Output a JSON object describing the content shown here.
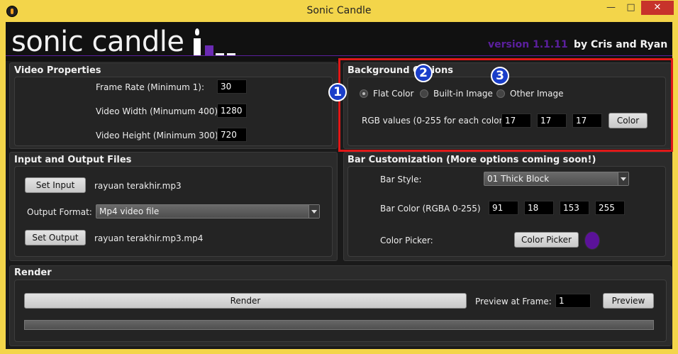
{
  "window": {
    "title": "Sonic Candle",
    "minimize": "—",
    "maximize": "□",
    "close": "✕"
  },
  "header": {
    "logo": "sonic candle",
    "version": "version 1.1.11",
    "authors": "by Cris and Ryan"
  },
  "video_properties": {
    "title": "Video Properties",
    "frame_rate_label": "Frame Rate (Minimum 1):",
    "frame_rate": "30",
    "width_label": "Video Width (Minumum 400):",
    "width": "1280",
    "height_label": "Video Height (Minimum 300):",
    "height": "720"
  },
  "background_options": {
    "title": "Background Options",
    "radios": [
      "Flat Color",
      "Built-in Image",
      "Other Image"
    ],
    "selected": "Flat Color",
    "rgb_label": "RGB values (0-255 for each color):",
    "r": "17",
    "g": "17",
    "b": "17",
    "color_button": "Color",
    "badges": [
      "1",
      "2",
      "3"
    ]
  },
  "io_files": {
    "title": "Input and Output Files",
    "set_input": "Set Input",
    "input_file": "rayuan terakhir.mp3",
    "format_label": "Output Format:",
    "format_value": "Mp4 video file",
    "set_output": "Set Output",
    "output_file": "rayuan terakhir.mp3.mp4"
  },
  "bar_customization": {
    "title": "Bar Customization (More options coming soon!)",
    "style_label": "Bar Style:",
    "style_value": "01 Thick Block",
    "color_label": "Bar Color (RGBA 0-255)",
    "r": "91",
    "g": "18",
    "b": "153",
    "a": "255",
    "picker_label": "Color Picker:",
    "picker_button": "Color Picker",
    "swatch_color": "#5b1299"
  },
  "render": {
    "title": "Render",
    "render_button": "Render",
    "preview_label": "Preview at Frame:",
    "preview_frame": "1",
    "preview_button": "Preview",
    "progress": 0
  },
  "colors": {
    "accent": "#5b1f9e",
    "highlight": "#e01818",
    "badge": "#1a3ec9",
    "title_bar": "#f3d54a"
  }
}
